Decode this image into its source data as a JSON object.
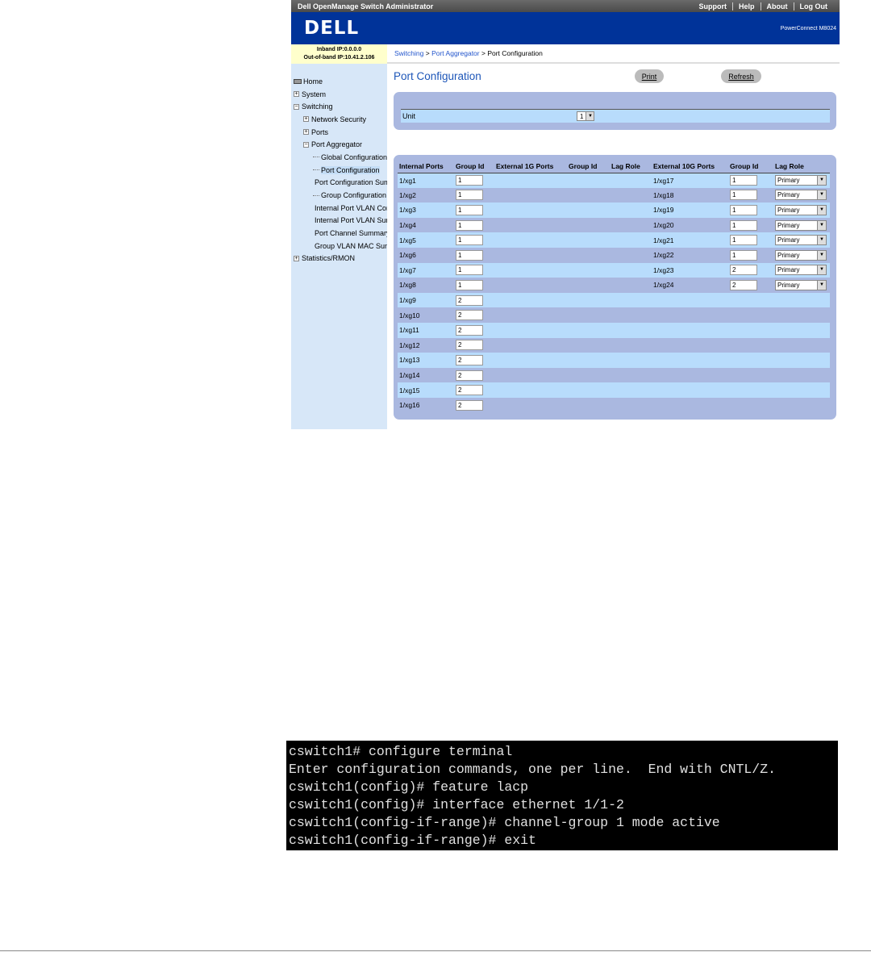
{
  "topbar": {
    "title": "Dell OpenManage Switch Administrator",
    "links": [
      "Support",
      "Help",
      "About",
      "Log Out"
    ]
  },
  "banner": {
    "logo": "DELL",
    "model": "PowerConnect M8024"
  },
  "ip": {
    "inband": "Inband IP:0.0.0.0",
    "outband": "Out-of-band IP:10.41.2.106"
  },
  "breadcrumb": {
    "a": "Switching",
    "b": "Port Aggregator",
    "c": "Port Configuration",
    "sep": " > "
  },
  "nav": [
    {
      "label": "Home",
      "level": 0,
      "icon": "home"
    },
    {
      "label": "System",
      "level": 0,
      "icon": "+"
    },
    {
      "label": "Switching",
      "level": 0,
      "icon": "-"
    },
    {
      "label": "Network Security",
      "level": 1,
      "icon": "+"
    },
    {
      "label": "Ports",
      "level": 1,
      "icon": "+"
    },
    {
      "label": "Port Aggregator",
      "level": 1,
      "icon": "-"
    },
    {
      "label": "Global Configuration",
      "level": 2
    },
    {
      "label": "Port Configuration",
      "level": 2,
      "selected": true
    },
    {
      "label": "Port Configuration Summary",
      "level": 2
    },
    {
      "label": "Group Configuration",
      "level": 2
    },
    {
      "label": "Internal Port VLAN Configuration",
      "level": 2
    },
    {
      "label": "Internal Port VLAN Summary",
      "level": 2
    },
    {
      "label": "Port Channel Summary",
      "level": 2
    },
    {
      "label": "Group VLAN MAC Summary",
      "level": 2
    },
    {
      "label": "Statistics/RMON",
      "level": 0,
      "icon": "+"
    }
  ],
  "page": {
    "title": "Port Configuration",
    "print": "Print",
    "refresh": "Refresh",
    "unit_label": "Unit",
    "unit_value": "1"
  },
  "table": {
    "headers": [
      "Internal Ports",
      "Group Id",
      "External 1G Ports",
      "Group Id",
      "Lag Role",
      "External 10G Ports",
      "Group Id",
      "Lag Role"
    ],
    "rows": [
      [
        "1/xg1",
        "1",
        "1/xg17",
        "1",
        "Primary"
      ],
      [
        "1/xg2",
        "1",
        "1/xg18",
        "1",
        "Primary"
      ],
      [
        "1/xg3",
        "1",
        "1/xg19",
        "1",
        "Primary"
      ],
      [
        "1/xg4",
        "1",
        "1/xg20",
        "1",
        "Primary"
      ],
      [
        "1/xg5",
        "1",
        "1/xg21",
        "1",
        "Primary"
      ],
      [
        "1/xg6",
        "1",
        "1/xg22",
        "1",
        "Primary"
      ],
      [
        "1/xg7",
        "1",
        "1/xg23",
        "2",
        "Primary"
      ],
      [
        "1/xg8",
        "1",
        "1/xg24",
        "2",
        "Primary"
      ],
      [
        "1/xg9",
        "2"
      ],
      [
        "1/xg10",
        "2"
      ],
      [
        "1/xg11",
        "2"
      ],
      [
        "1/xg12",
        "2"
      ],
      [
        "1/xg13",
        "2"
      ],
      [
        "1/xg14",
        "2"
      ],
      [
        "1/xg15",
        "2"
      ],
      [
        "1/xg16",
        "2"
      ]
    ]
  },
  "terminal": [
    "cswitch1# configure terminal",
    "Enter configuration commands, one per line.  End with CNTL/Z.",
    "cswitch1(config)# feature lacp",
    "cswitch1(config)# interface ethernet 1/1-2",
    "cswitch1(config-if-range)# channel-group 1 mode active",
    "cswitch1(config-if-range)# exit"
  ]
}
